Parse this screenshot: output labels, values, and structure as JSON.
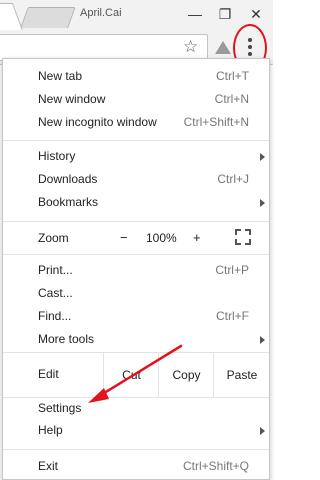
{
  "browser": {
    "profile_name": "April.Cai",
    "window_controls": {
      "minimize": "—",
      "restore": "❐",
      "close": "✕"
    },
    "icons": [
      "star-icon",
      "drive-icon",
      "menu-kebab-icon"
    ]
  },
  "menu": {
    "new_tab": {
      "label": "New tab",
      "shortcut": "Ctrl+T"
    },
    "new_window": {
      "label": "New window",
      "shortcut": "Ctrl+N"
    },
    "new_incognito": {
      "label": "New incognito window",
      "shortcut": "Ctrl+Shift+N"
    },
    "history": {
      "label": "History"
    },
    "downloads": {
      "label": "Downloads",
      "shortcut": "Ctrl+J"
    },
    "bookmarks": {
      "label": "Bookmarks"
    },
    "zoom": {
      "label": "Zoom",
      "minus": "−",
      "level": "100%",
      "plus": "+"
    },
    "print": {
      "label": "Print...",
      "shortcut": "Ctrl+P"
    },
    "cast": {
      "label": "Cast..."
    },
    "find": {
      "label": "Find...",
      "shortcut": "Ctrl+F"
    },
    "more_tools": {
      "label": "More tools"
    },
    "edit": {
      "label": "Edit",
      "cut": "Cut",
      "copy": "Copy",
      "paste": "Paste"
    },
    "settings": {
      "label": "Settings"
    },
    "help": {
      "label": "Help"
    },
    "exit": {
      "label": "Exit",
      "shortcut": "Ctrl+Shift+Q"
    }
  },
  "annotation": {
    "color": "#e3131b"
  }
}
